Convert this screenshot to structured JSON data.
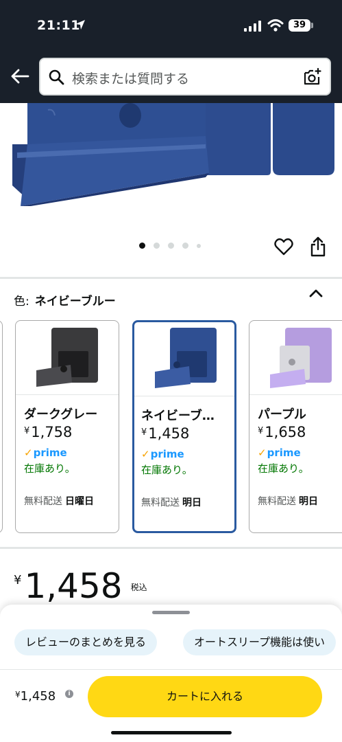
{
  "status_bar": {
    "time": "21:11",
    "battery": "39"
  },
  "search": {
    "placeholder": "検索または質問する"
  },
  "color_selector": {
    "label": "色:",
    "selected": "ネイビーブルー",
    "options": [
      {
        "name": "ダークグレー",
        "currency": "¥",
        "price": "1,758",
        "prime": "prime",
        "stock": "在庫あり。",
        "ship_label": "無料配送",
        "ship_day": "日曜日",
        "swatch": "#3a3a3c"
      },
      {
        "name": "ネイビーブ…",
        "currency": "¥",
        "price": "1,458",
        "prime": "prime",
        "stock": "在庫あり。",
        "ship_label": "無料配送",
        "ship_day": "明日",
        "swatch": "#2f4f92"
      },
      {
        "name": "パープル",
        "currency": "¥",
        "price": "1,658",
        "prime": "prime",
        "stock": "在庫あり。",
        "ship_label": "無料配送",
        "ship_day": "明日",
        "swatch": "#b59ddf"
      }
    ]
  },
  "price": {
    "currency": "¥",
    "amount": "1,458",
    "tax_note": "税込"
  },
  "chips": [
    "レビューのまとめを見る",
    "オートスリープ機能は使い"
  ],
  "bottom_bar": {
    "currency": "¥",
    "price": "1,458",
    "cart_label": "カートに入れる",
    "accent": "#ffd814"
  }
}
